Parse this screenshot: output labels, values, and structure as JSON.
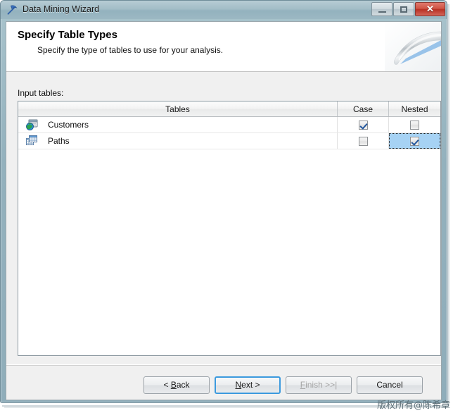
{
  "window": {
    "title": "Data Mining Wizard",
    "icon": "pickaxe-icon",
    "controls": {
      "minimize_label": "",
      "maximize_label": "",
      "close_label": "✕"
    }
  },
  "banner": {
    "title": "Specify Table Types",
    "subtitle": "Specify the type of tables to use for your analysis."
  },
  "body": {
    "input_tables_label": "Input tables:"
  },
  "grid": {
    "columns": [
      "Tables",
      "Case",
      "Nested"
    ],
    "rows": [
      {
        "icon": "globe-view-icon",
        "name": "Customers",
        "case_checked": true,
        "nested_checked": false,
        "case_selected": false,
        "nested_selected": false
      },
      {
        "icon": "table-grid-icon",
        "name": "Paths",
        "case_checked": false,
        "nested_checked": true,
        "case_selected": false,
        "nested_selected": true
      }
    ]
  },
  "buttons": {
    "back": {
      "prefix": "< ",
      "accel": "B",
      "suffix": "ack",
      "enabled": true,
      "focused": false
    },
    "next": {
      "prefix": "",
      "accel": "N",
      "suffix": "ext >",
      "enabled": true,
      "focused": true
    },
    "finish": {
      "prefix": "",
      "accel": "F",
      "suffix": "inish >>|",
      "enabled": false,
      "focused": false
    },
    "cancel": {
      "prefix": "",
      "accel": "",
      "suffix": "Cancel",
      "enabled": true,
      "focused": false
    }
  },
  "watermark": {
    "text": "版权所有@陈希章"
  },
  "colors": {
    "titlebar": "#93b2be",
    "close_button": "#b93124",
    "focus_border": "#3c9ade",
    "selection": "#a6d2f4",
    "check_mark": "#21559c"
  }
}
